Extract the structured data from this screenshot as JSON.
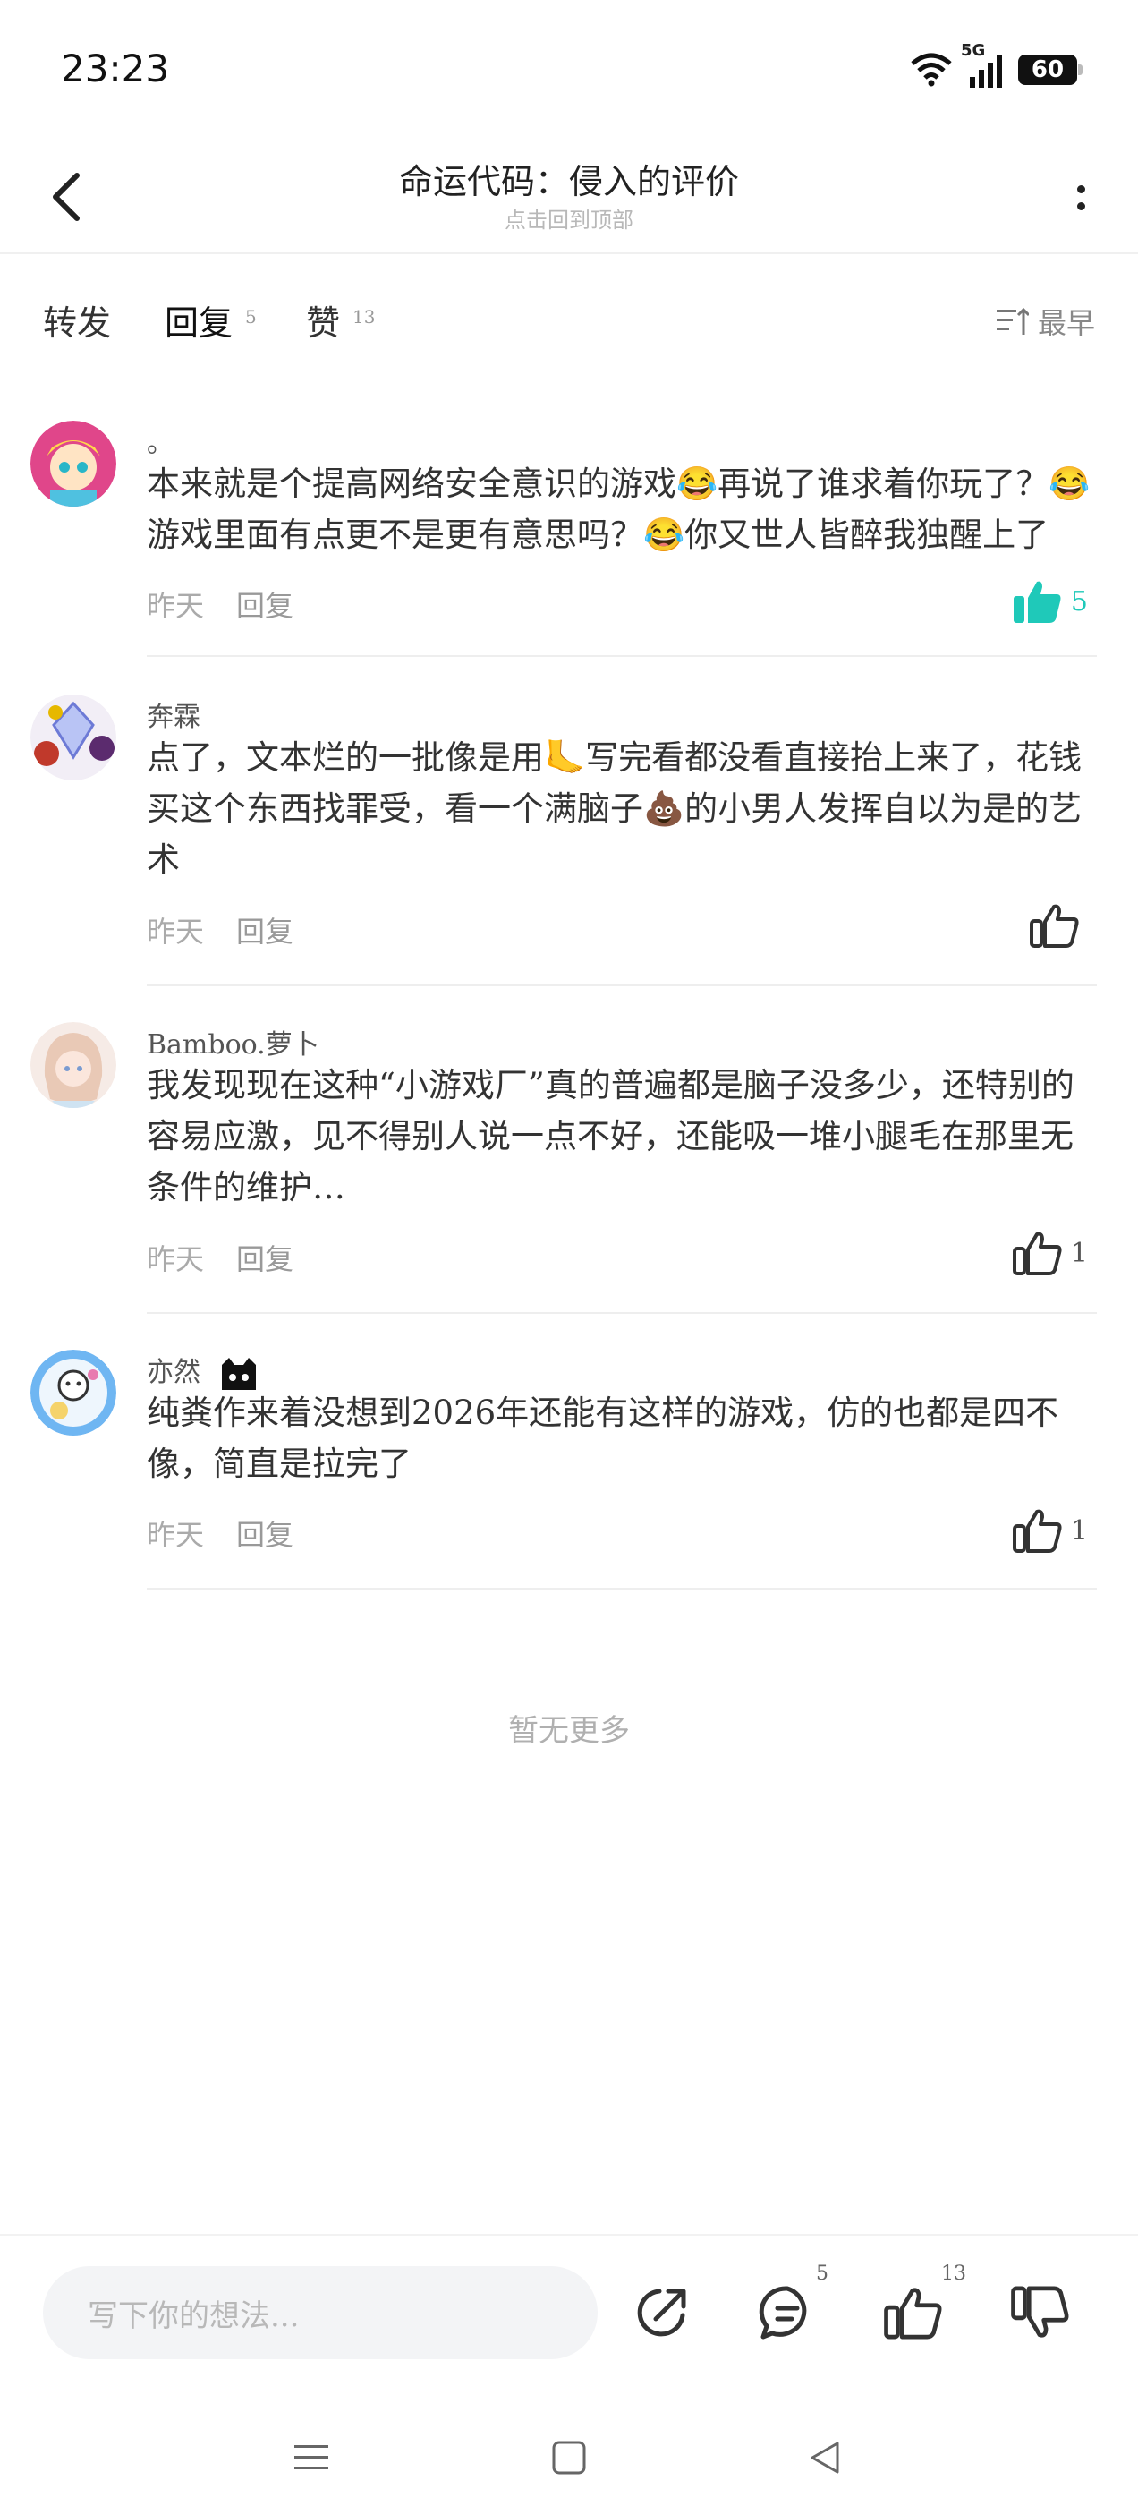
{
  "status": {
    "time": "23:23",
    "network": "5G",
    "battery": "60"
  },
  "header": {
    "title": "命运代码：侵入的评价",
    "subtitle": "点击回到顶部"
  },
  "tabs": [
    {
      "label": "转发",
      "count": ""
    },
    {
      "label": "回复",
      "count": "5"
    },
    {
      "label": "赞",
      "count": "13"
    }
  ],
  "sort": {
    "label": "最早"
  },
  "comments": [
    {
      "name": "。",
      "body": "本来就是个提高网络安全意识的游戏😂再说了谁求着你玩了？😂游戏里面有点更不是更有意思吗？😂你又世人皆醉我独醒上了",
      "time": "昨天",
      "reply_label": "回复",
      "likes": "5",
      "liked": true
    },
    {
      "name": "奔霖",
      "body": "点了，文本烂的一批像是用🦶写完看都没看直接抬上来了，花钱买这个东西找罪受，看一个满脑子💩的小男人发挥自以为是的艺术",
      "time": "昨天",
      "reply_label": "回复",
      "likes": "",
      "liked": false
    },
    {
      "name": "Bamboo.萝卜",
      "body": "我发现现在这种“小游戏厂”真的普遍都是脑子没多少，还特别的容易应激，见不得别人说一点不好，还能吸一堆小腿毛在那里无条件的维护…",
      "time": "昨天",
      "reply_label": "回复",
      "likes": "1",
      "liked": false
    },
    {
      "name": "亦然",
      "body": "纯粪作来着没想到2026年还能有这样的游戏，仿的也都是四不像，简直是拉完了",
      "time": "昨天",
      "reply_label": "回复",
      "likes": "1",
      "liked": false
    }
  ],
  "footer": {
    "no_more": "暂无更多"
  },
  "bottom_bar": {
    "input_placeholder": "写下你的想法...",
    "reply_count": "5",
    "like_count": "13"
  },
  "colors": {
    "accent": "#1fd1c1",
    "text": "#333333",
    "muted": "#aaaaaa"
  },
  "icons": [
    "back-icon",
    "more-icon",
    "sort-icon",
    "like-icon",
    "share-icon",
    "comment-icon",
    "dislike-icon",
    "menu-icon",
    "home-icon",
    "back-nav-icon"
  ]
}
